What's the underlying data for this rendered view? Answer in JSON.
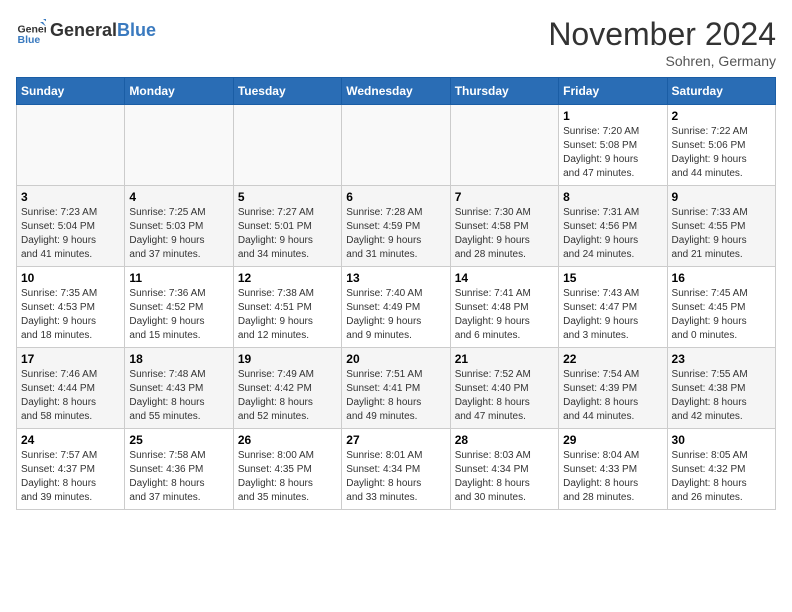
{
  "header": {
    "logo_general": "General",
    "logo_blue": "Blue",
    "month": "November 2024",
    "location": "Sohren, Germany"
  },
  "weekdays": [
    "Sunday",
    "Monday",
    "Tuesday",
    "Wednesday",
    "Thursday",
    "Friday",
    "Saturday"
  ],
  "weeks": [
    [
      {
        "day": "",
        "info": ""
      },
      {
        "day": "",
        "info": ""
      },
      {
        "day": "",
        "info": ""
      },
      {
        "day": "",
        "info": ""
      },
      {
        "day": "",
        "info": ""
      },
      {
        "day": "1",
        "info": "Sunrise: 7:20 AM\nSunset: 5:08 PM\nDaylight: 9 hours\nand 47 minutes."
      },
      {
        "day": "2",
        "info": "Sunrise: 7:22 AM\nSunset: 5:06 PM\nDaylight: 9 hours\nand 44 minutes."
      }
    ],
    [
      {
        "day": "3",
        "info": "Sunrise: 7:23 AM\nSunset: 5:04 PM\nDaylight: 9 hours\nand 41 minutes."
      },
      {
        "day": "4",
        "info": "Sunrise: 7:25 AM\nSunset: 5:03 PM\nDaylight: 9 hours\nand 37 minutes."
      },
      {
        "day": "5",
        "info": "Sunrise: 7:27 AM\nSunset: 5:01 PM\nDaylight: 9 hours\nand 34 minutes."
      },
      {
        "day": "6",
        "info": "Sunrise: 7:28 AM\nSunset: 4:59 PM\nDaylight: 9 hours\nand 31 minutes."
      },
      {
        "day": "7",
        "info": "Sunrise: 7:30 AM\nSunset: 4:58 PM\nDaylight: 9 hours\nand 28 minutes."
      },
      {
        "day": "8",
        "info": "Sunrise: 7:31 AM\nSunset: 4:56 PM\nDaylight: 9 hours\nand 24 minutes."
      },
      {
        "day": "9",
        "info": "Sunrise: 7:33 AM\nSunset: 4:55 PM\nDaylight: 9 hours\nand 21 minutes."
      }
    ],
    [
      {
        "day": "10",
        "info": "Sunrise: 7:35 AM\nSunset: 4:53 PM\nDaylight: 9 hours\nand 18 minutes."
      },
      {
        "day": "11",
        "info": "Sunrise: 7:36 AM\nSunset: 4:52 PM\nDaylight: 9 hours\nand 15 minutes."
      },
      {
        "day": "12",
        "info": "Sunrise: 7:38 AM\nSunset: 4:51 PM\nDaylight: 9 hours\nand 12 minutes."
      },
      {
        "day": "13",
        "info": "Sunrise: 7:40 AM\nSunset: 4:49 PM\nDaylight: 9 hours\nand 9 minutes."
      },
      {
        "day": "14",
        "info": "Sunrise: 7:41 AM\nSunset: 4:48 PM\nDaylight: 9 hours\nand 6 minutes."
      },
      {
        "day": "15",
        "info": "Sunrise: 7:43 AM\nSunset: 4:47 PM\nDaylight: 9 hours\nand 3 minutes."
      },
      {
        "day": "16",
        "info": "Sunrise: 7:45 AM\nSunset: 4:45 PM\nDaylight: 9 hours\nand 0 minutes."
      }
    ],
    [
      {
        "day": "17",
        "info": "Sunrise: 7:46 AM\nSunset: 4:44 PM\nDaylight: 8 hours\nand 58 minutes."
      },
      {
        "day": "18",
        "info": "Sunrise: 7:48 AM\nSunset: 4:43 PM\nDaylight: 8 hours\nand 55 minutes."
      },
      {
        "day": "19",
        "info": "Sunrise: 7:49 AM\nSunset: 4:42 PM\nDaylight: 8 hours\nand 52 minutes."
      },
      {
        "day": "20",
        "info": "Sunrise: 7:51 AM\nSunset: 4:41 PM\nDaylight: 8 hours\nand 49 minutes."
      },
      {
        "day": "21",
        "info": "Sunrise: 7:52 AM\nSunset: 4:40 PM\nDaylight: 8 hours\nand 47 minutes."
      },
      {
        "day": "22",
        "info": "Sunrise: 7:54 AM\nSunset: 4:39 PM\nDaylight: 8 hours\nand 44 minutes."
      },
      {
        "day": "23",
        "info": "Sunrise: 7:55 AM\nSunset: 4:38 PM\nDaylight: 8 hours\nand 42 minutes."
      }
    ],
    [
      {
        "day": "24",
        "info": "Sunrise: 7:57 AM\nSunset: 4:37 PM\nDaylight: 8 hours\nand 39 minutes."
      },
      {
        "day": "25",
        "info": "Sunrise: 7:58 AM\nSunset: 4:36 PM\nDaylight: 8 hours\nand 37 minutes."
      },
      {
        "day": "26",
        "info": "Sunrise: 8:00 AM\nSunset: 4:35 PM\nDaylight: 8 hours\nand 35 minutes."
      },
      {
        "day": "27",
        "info": "Sunrise: 8:01 AM\nSunset: 4:34 PM\nDaylight: 8 hours\nand 33 minutes."
      },
      {
        "day": "28",
        "info": "Sunrise: 8:03 AM\nSunset: 4:34 PM\nDaylight: 8 hours\nand 30 minutes."
      },
      {
        "day": "29",
        "info": "Sunrise: 8:04 AM\nSunset: 4:33 PM\nDaylight: 8 hours\nand 28 minutes."
      },
      {
        "day": "30",
        "info": "Sunrise: 8:05 AM\nSunset: 4:32 PM\nDaylight: 8 hours\nand 26 minutes."
      }
    ]
  ]
}
